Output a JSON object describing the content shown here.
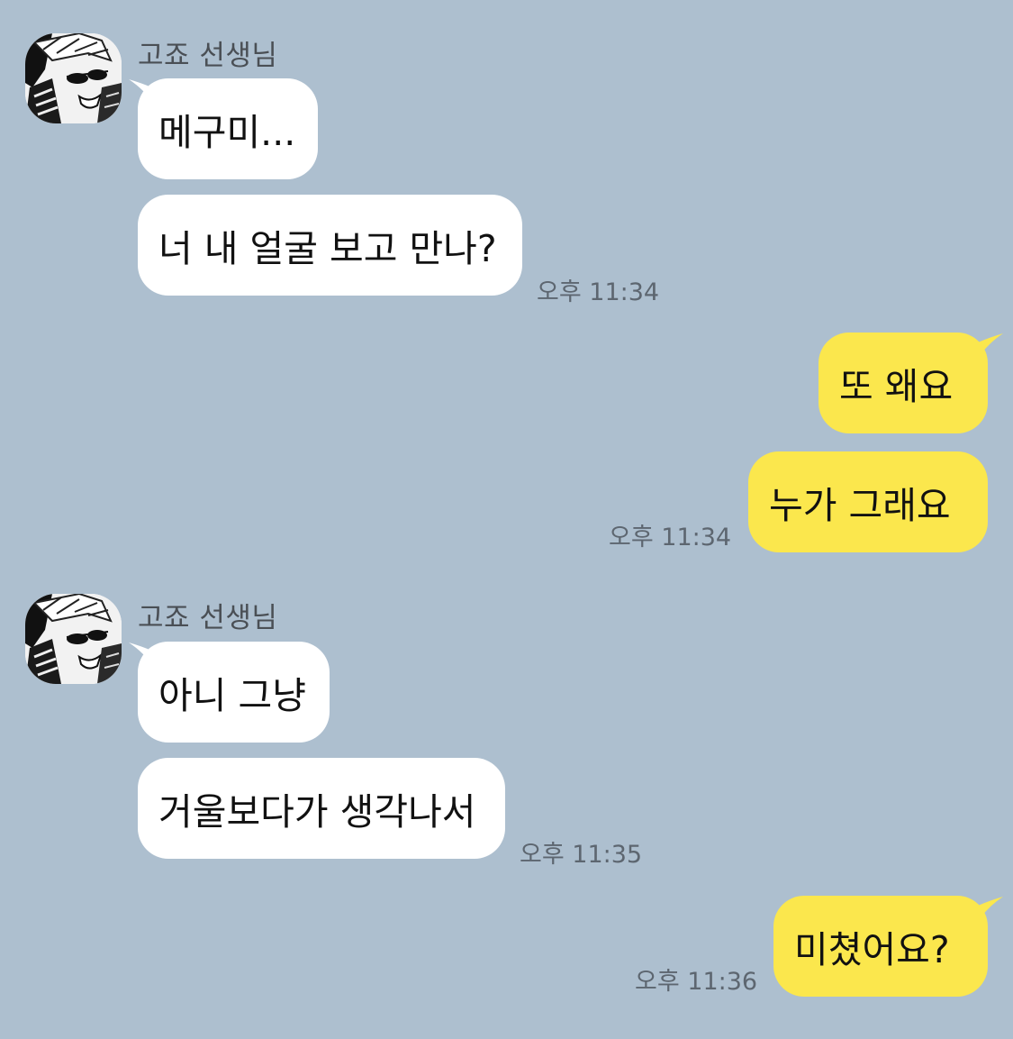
{
  "chat": {
    "groups": [
      {
        "sender": "고죠 선생님",
        "messages": [
          "메구미...",
          "너 내 얼굴 보고 만나?"
        ],
        "time": "오후 11:34"
      },
      {
        "sender": "me",
        "messages": [
          "또 왜요",
          "누가 그래요"
        ],
        "time": "오후 11:34"
      },
      {
        "sender": "고죠 선생님",
        "messages": [
          "아니 그냥",
          "거울보다가 생각나서"
        ],
        "time": "오후 11:35"
      },
      {
        "sender": "me",
        "messages": [
          "미쳤어요?"
        ],
        "time": "오후 11:36"
      }
    ]
  },
  "colors": {
    "background": "#adbfcf",
    "incoming_bubble": "#ffffff",
    "outgoing_bubble": "#fbe74d"
  },
  "icons": {
    "avatar": "profile-avatar-manga-character"
  }
}
